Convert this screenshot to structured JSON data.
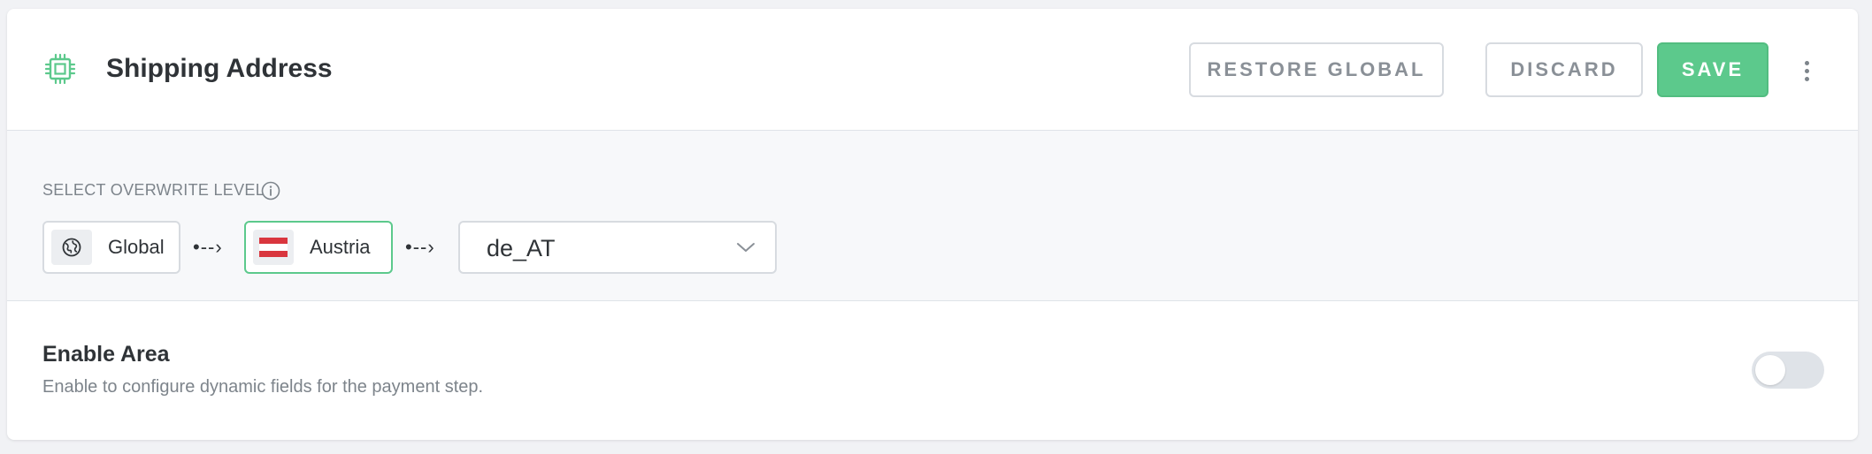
{
  "header": {
    "title": "Shipping Address",
    "icon": "cpu-icon",
    "restore_label": "RESTORE GLOBAL",
    "discard_label": "DISCARD",
    "save_label": "SAVE"
  },
  "overwrite_level": {
    "label": "SELECT OVERWRITE LEVEL",
    "levels": [
      {
        "label": "Global",
        "icon": "globe-icon",
        "active": false
      },
      {
        "label": "Austria",
        "icon": "austria-flag-icon",
        "active": true
      }
    ],
    "separator": "•--›",
    "locale": {
      "selected": "de_AT"
    }
  },
  "enable_area": {
    "title": "Enable Area",
    "description": "Enable to configure dynamic fields for the payment step.",
    "enabled": false
  },
  "colors": {
    "accent": "#5cc98c",
    "austria_red": "#d9363e"
  }
}
